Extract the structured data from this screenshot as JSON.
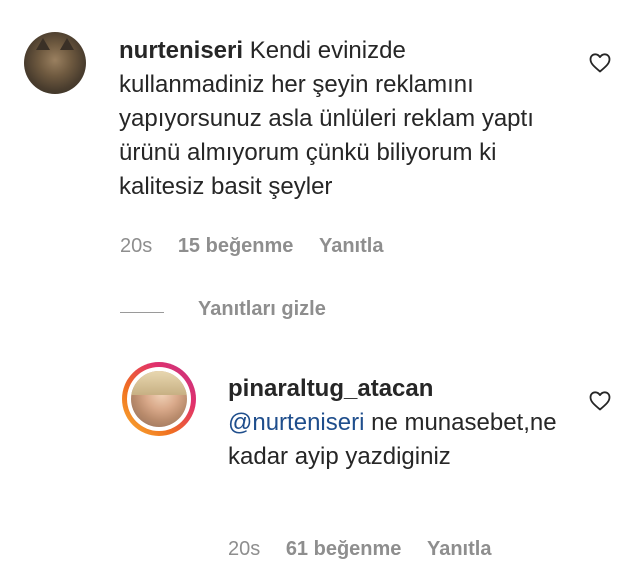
{
  "comments": [
    {
      "username": "nurteniseri",
      "text": "Kendi evinizde kullanmadiniz her şeyin reklamını yapıyorsunuz asla ünlüleri reklam yaptı ürünü almıyorum çünkü biliyorum ki kalitesiz basit şeyler",
      "time": "20s",
      "likes": "15 beğenme",
      "reply_label": "Yanıtla",
      "icons": {
        "avatar": "cat-avatar",
        "like": "heart-icon"
      }
    }
  ],
  "replies_toggle": "Yanıtları gizle",
  "reply": {
    "username": "pinaraltug_atacan",
    "mention": "@nurteniseri",
    "text": "ne munasebet,ne kadar ayip yazdiginiz",
    "time": "20s",
    "likes": "61 beğenme",
    "reply_label": "Yanıtla",
    "icons": {
      "avatar": "story-ring-avatar",
      "like": "heart-icon"
    }
  },
  "colors": {
    "text": "#262626",
    "meta": "#8e8e8e",
    "mention": "#1f4e8c",
    "story_ring": [
      "#f9b233",
      "#e1306c",
      "#c13584"
    ]
  }
}
